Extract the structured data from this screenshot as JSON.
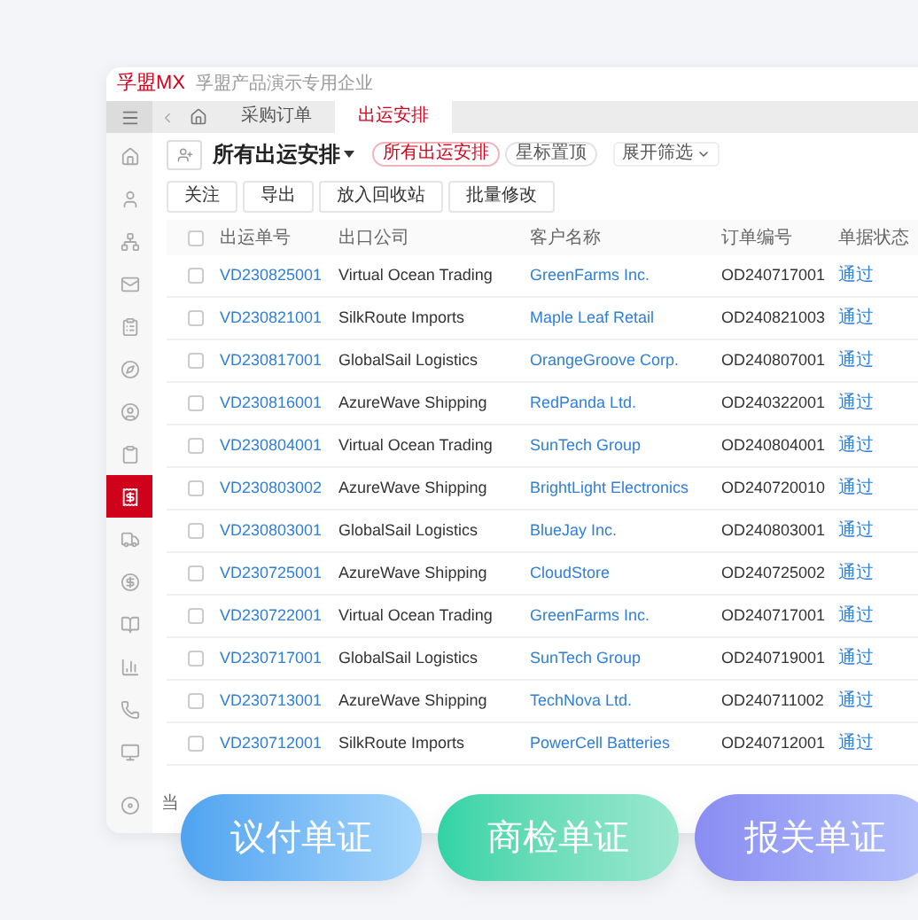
{
  "header": {
    "logo_brand": "孚盟",
    "logo_suffix": "MX",
    "company": "孚盟产品演示专用企业"
  },
  "tabs": [
    {
      "label": "采购订单",
      "selected": false
    },
    {
      "label": "出运安排",
      "selected": true
    }
  ],
  "sidebar": {
    "items": [
      {
        "selected": false
      },
      {
        "selected": false
      },
      {
        "selected": false
      },
      {
        "selected": false
      },
      {
        "selected": false
      },
      {
        "selected": false
      },
      {
        "selected": false
      },
      {
        "selected": false
      },
      {
        "selected": true
      },
      {
        "selected": false
      },
      {
        "selected": false
      },
      {
        "selected": false
      },
      {
        "selected": false
      },
      {
        "selected": false
      },
      {
        "selected": false
      },
      {
        "selected": false
      }
    ]
  },
  "view": {
    "title": "所有出运安排",
    "filters": [
      {
        "label": "所有出运安排",
        "selected": true
      },
      {
        "label": "星标置顶",
        "selected": false
      }
    ],
    "expand_filter": "展开筛选"
  },
  "actions": [
    "关注",
    "导出",
    "放入回收站",
    "批量修改"
  ],
  "table": {
    "header_checked": false,
    "columns": [
      "出运单号",
      "出口公司",
      "客户名称",
      "订单编号",
      "单据状态"
    ],
    "rows": [
      {
        "checked": false,
        "cells": [
          "VD230825001",
          "Virtual Ocean Trading",
          "GreenFarms Inc.",
          "OD240717001",
          "通过"
        ]
      },
      {
        "checked": false,
        "cells": [
          "VD230821001",
          "SilkRoute Imports",
          "Maple Leaf Retail",
          "OD240821003",
          "通过"
        ]
      },
      {
        "checked": false,
        "cells": [
          "VD230817001",
          "GlobalSail Logistics",
          "OrangeGroove Corp.",
          "OD240807001",
          "通过"
        ]
      },
      {
        "checked": false,
        "cells": [
          "VD230816001",
          "AzureWave Shipping",
          "RedPanda Ltd.",
          "OD240322001",
          "通过"
        ]
      },
      {
        "checked": false,
        "cells": [
          "VD230804001",
          "Virtual Ocean Trading",
          "SunTech Group",
          "OD240804001",
          "通过"
        ]
      },
      {
        "checked": false,
        "cells": [
          "VD230803002",
          "AzureWave Shipping",
          "BrightLight Electronics",
          "OD240720010",
          "通过"
        ]
      },
      {
        "checked": false,
        "cells": [
          "VD230803001",
          "GlobalSail Logistics",
          "BlueJay Inc.",
          "OD240803001",
          "通过"
        ]
      },
      {
        "checked": false,
        "cells": [
          "VD230725001",
          "AzureWave Shipping",
          "CloudStore",
          "OD240725002",
          "通过"
        ]
      },
      {
        "checked": false,
        "cells": [
          "VD230722001",
          "Virtual Ocean Trading",
          "GreenFarms Inc.",
          "OD240717001",
          "通过"
        ]
      },
      {
        "checked": false,
        "cells": [
          "VD230717001",
          "GlobalSail Logistics",
          "SunTech Group",
          "OD240719001",
          "通过"
        ]
      },
      {
        "checked": false,
        "cells": [
          "VD230713001",
          "AzureWave Shipping",
          "TechNova Ltd.",
          "OD240711002",
          "通过"
        ]
      },
      {
        "checked": false,
        "cells": [
          "VD230712001",
          "SilkRoute Imports",
          "PowerCell Batteries",
          "OD240712001",
          "通过"
        ]
      }
    ]
  },
  "footer": "当",
  "promo_buttons": [
    {
      "label": "议付单证",
      "kind": "blue"
    },
    {
      "label": "商检单证",
      "kind": "green"
    },
    {
      "label": "报关单证",
      "kind": "purple"
    }
  ]
}
